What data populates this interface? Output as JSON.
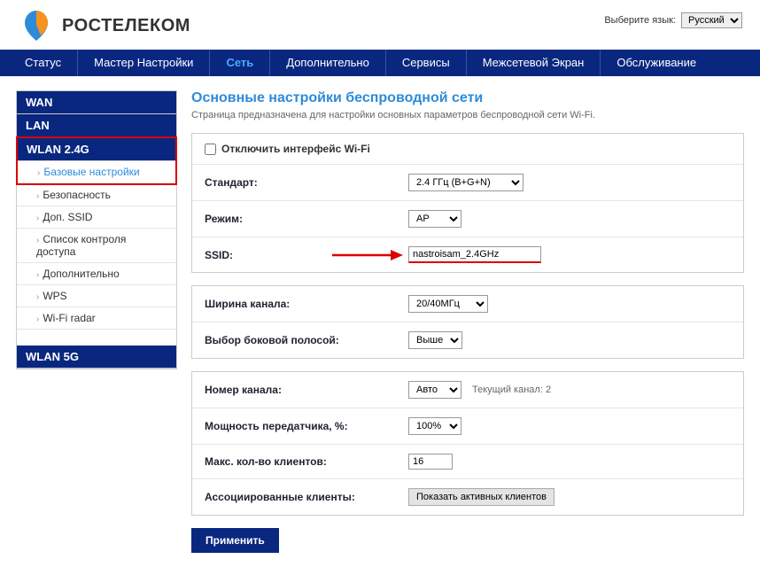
{
  "header": {
    "brand": "РОСТЕЛЕКОМ",
    "lang_label": "Выберите язык:",
    "lang_value": "Русский"
  },
  "nav": {
    "items": [
      "Статус",
      "Мастер Настройки",
      "Сеть",
      "Дополнительно",
      "Сервисы",
      "Межсетевой Экран",
      "Обслуживание"
    ],
    "active_index": 2
  },
  "sidebar": {
    "groups": [
      {
        "title": "WAN",
        "items": []
      },
      {
        "title": "LAN",
        "items": []
      },
      {
        "title": "WLAN 2.4G",
        "highlight": true,
        "items": [
          {
            "label": "Базовые настройки",
            "active": true,
            "in_highlight": true
          },
          {
            "label": "Безопасность"
          },
          {
            "label": "Доп. SSID"
          },
          {
            "label": "Список контроля доступа"
          },
          {
            "label": "Дополнительно"
          },
          {
            "label": "WPS"
          },
          {
            "label": "Wi-Fi radar"
          }
        ]
      },
      {
        "title": "WLAN 5G",
        "items": []
      }
    ]
  },
  "page": {
    "title": "Основные настройки беспроводной сети",
    "desc": "Страница предназначена для настройки основных параметров беспроводной сети Wi-Fi."
  },
  "form": {
    "disable_wifi_label": "Отключить интерфейс Wi-Fi",
    "standard_label": "Стандарт:",
    "standard_value": "2.4 ГГц (B+G+N)",
    "mode_label": "Режим:",
    "mode_value": "AP",
    "ssid_label": "SSID:",
    "ssid_value": "nastroisam_2.4GHz",
    "bw_label": "Ширина канала:",
    "bw_value": "20/40МГц",
    "sideband_label": "Выбор боковой полосой:",
    "sideband_value": "Выше",
    "channel_label": "Номер канала:",
    "channel_value": "Авто",
    "channel_hint": "Текущий канал: 2",
    "power_label": "Мощность передатчика, %:",
    "power_value": "100%",
    "max_clients_label": "Макс. кол-во клиентов:",
    "max_clients_value": "16",
    "assoc_label": "Ассоциированные клиенты:",
    "assoc_btn": "Показать активных клиентов",
    "apply": "Применить"
  }
}
